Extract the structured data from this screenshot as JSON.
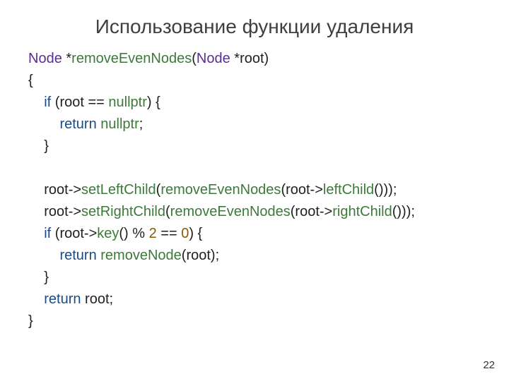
{
  "title": "Использование функции удаления",
  "page_number": "22",
  "code": {
    "type1": "Node",
    "star1": " *",
    "fn": "removeEvenNodes",
    "lp1": "(",
    "type2": "Node",
    "star2": " *",
    "param": "root",
    "rp1": ")",
    "obrace": "{",
    "indent1": "    ",
    "indent2": "        ",
    "if1_kw": "if",
    "if1_rest_a": " (root == ",
    "if1_null": "nullptr",
    "if1_rest_b": ") {",
    "ret1_kw": "return",
    "ret1_sp": " ",
    "ret1_null": "nullptr",
    "ret1_semi": ";",
    "cbrace1": "}",
    "line_set_left_a": "root->",
    "line_set_left_fn": "setLeftChild",
    "line_set_left_b": "(",
    "line_set_left_call": "removeEvenNodes",
    "line_set_left_c": "(root->",
    "line_set_left_member": "leftChild",
    "line_set_left_d": "()));",
    "line_set_right_a": "root->",
    "line_set_right_fn": "setRightChild",
    "line_set_right_b": "(",
    "line_set_right_call": "removeEvenNodes",
    "line_set_right_c": "(root->",
    "line_set_right_member": "rightChild",
    "line_set_right_d": "()));",
    "if2_kw": "if",
    "if2_a": " (root->",
    "if2_key": "key",
    "if2_b": "() % ",
    "if2_num2": "2",
    "if2_c": " == ",
    "if2_num0": "0",
    "if2_d": ") {",
    "ret2_kw": "return",
    "ret2_sp": " ",
    "ret2_fn": "removeNode",
    "ret2_rest": "(root);",
    "cbrace2": "}",
    "ret3_kw": "return",
    "ret3_rest": " root;",
    "cbrace3": "}"
  }
}
